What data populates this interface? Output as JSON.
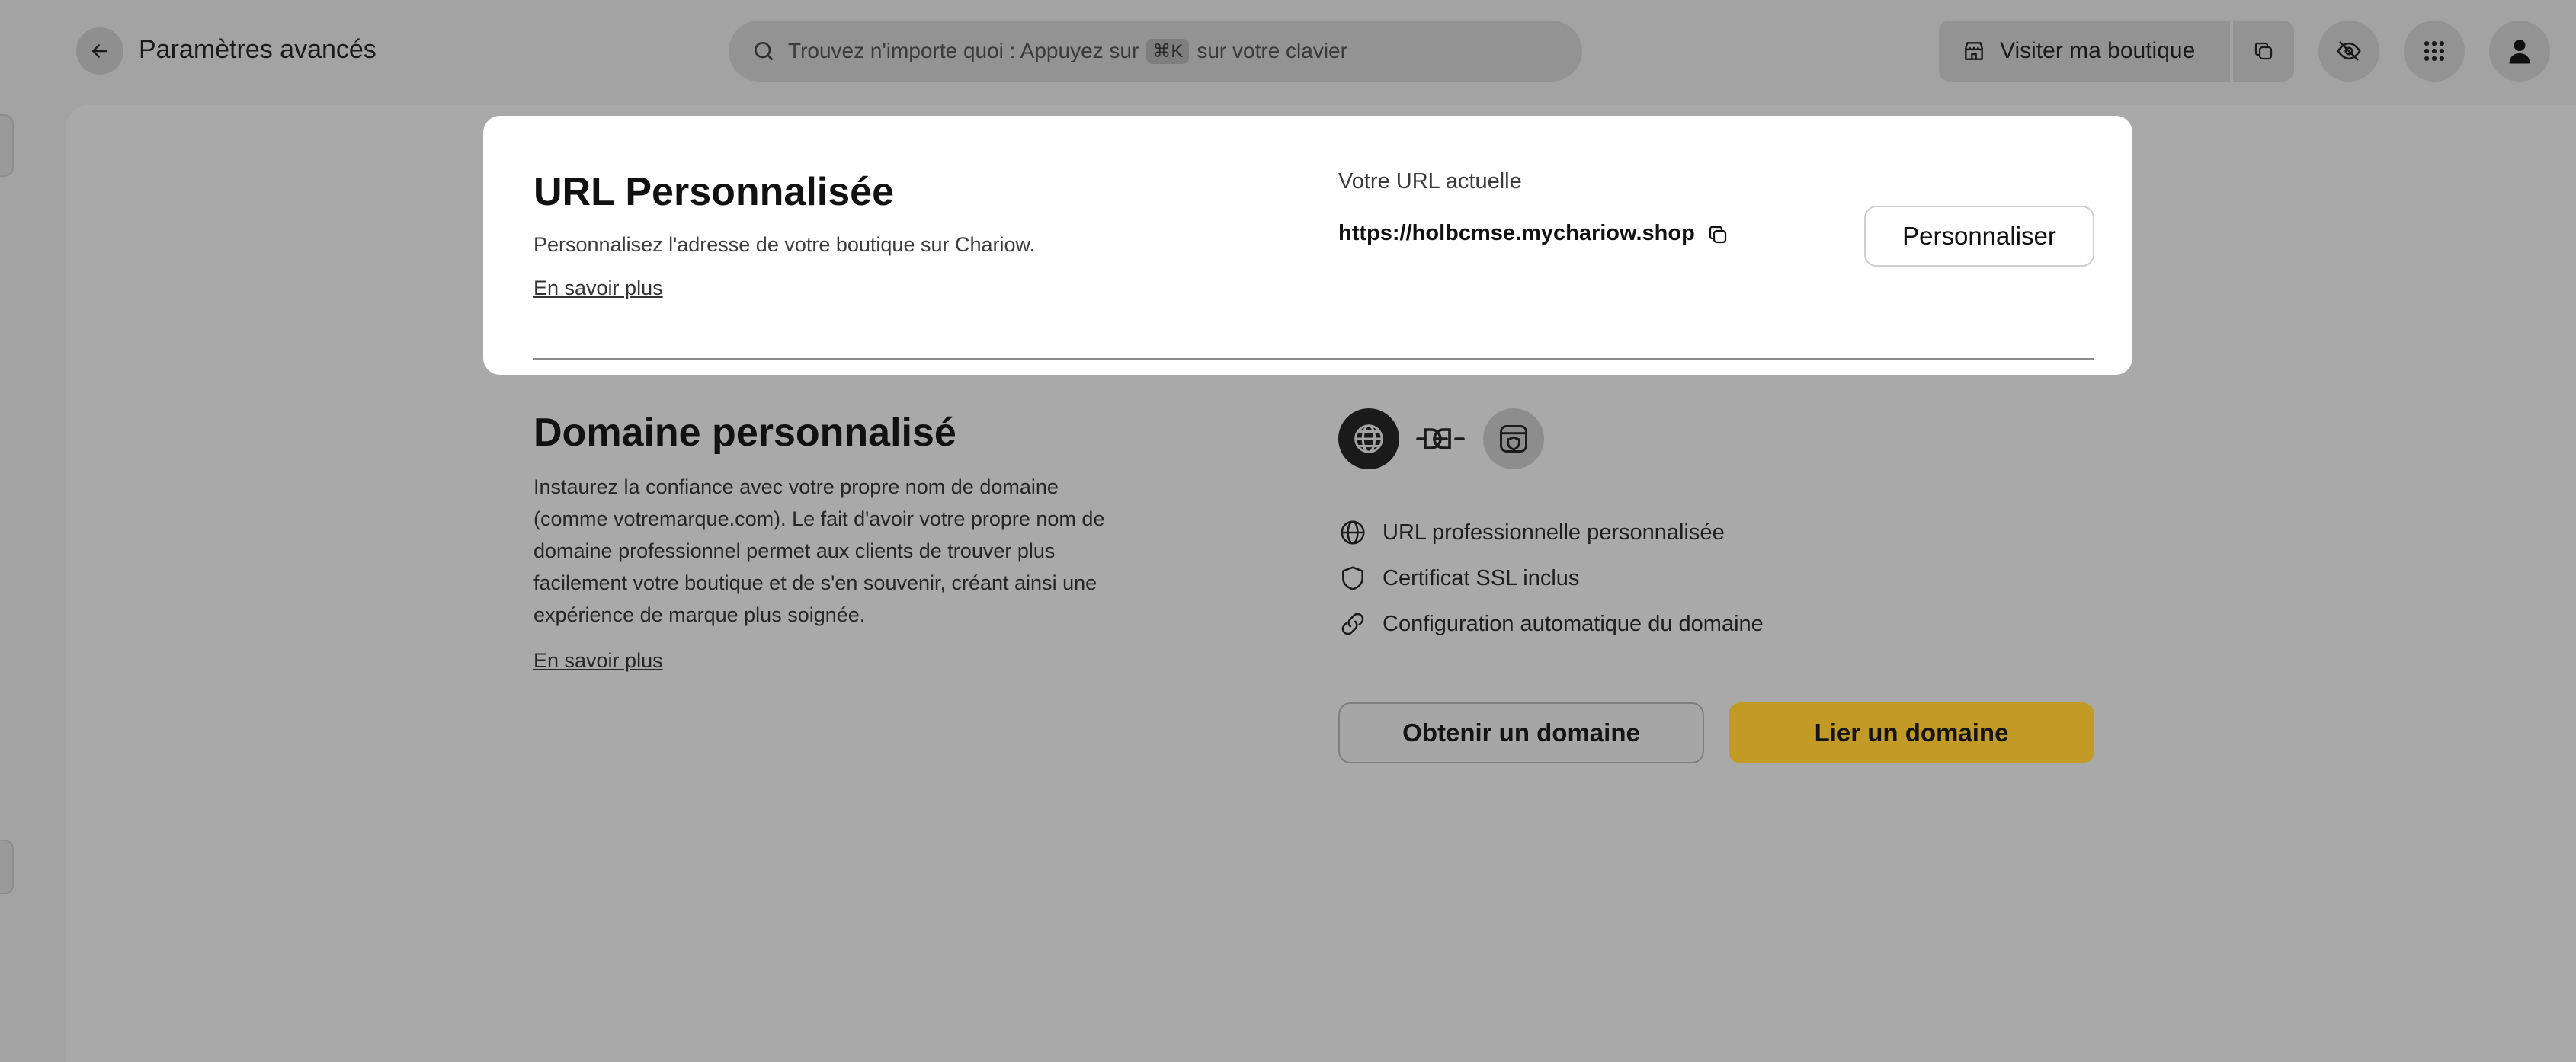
{
  "header": {
    "back_icon": "arrow-left-icon",
    "title": "Paramètres avancés",
    "search": {
      "icon": "search-icon",
      "text_before": "Trouvez n'importe quoi : Appuyez sur",
      "shortcut": "⌘K",
      "text_after": "sur votre clavier"
    },
    "visit_label": "Visiter ma boutique",
    "visit_icon": "store-icon",
    "actions": [
      "copy-icon",
      "eye-off-icon",
      "apps-grid-icon",
      "user-icon"
    ]
  },
  "url_section": {
    "title": "URL Personnalisée",
    "description": "Personnalisez l'adresse de votre boutique sur Chariow.",
    "learn_more": "En savoir plus",
    "current_label": "Votre URL actuelle",
    "current_url": "https://holbcmse.mychariow.shop",
    "customize_button": "Personnaliser"
  },
  "domain_section": {
    "title": "Domaine personnalisé",
    "description_lines": [
      "Instaurez la confiance avec votre propre nom de domaine",
      "(comme votremarque.com). Le fait d'avoir votre propre nom de",
      "domaine professionnel permet aux clients de trouver plus",
      "facilement votre boutique et de s'en souvenir, créant ainsi une",
      "expérience de marque plus soignée."
    ],
    "learn_more": "En savoir plus",
    "features": [
      {
        "icon": "globe-icon",
        "label": "URL professionnelle personnalisée"
      },
      {
        "icon": "shield-icon",
        "label": "Certificat SSL inclus"
      },
      {
        "icon": "link-icon",
        "label": "Configuration automatique du domaine"
      }
    ],
    "get_domain_button": "Obtenir un domaine",
    "link_domain_button": "Lier un domaine"
  },
  "colors": {
    "overlay": "#a3a3a3",
    "accent_dimmed": "#c29a26",
    "modal_bg": "#ffffff"
  }
}
